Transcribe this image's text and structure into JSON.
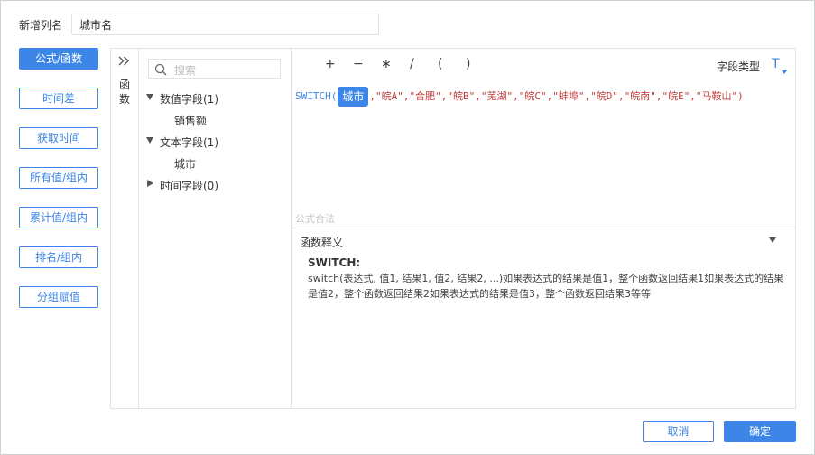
{
  "header": {
    "column_name_label": "新增列名",
    "column_name_value": "城市名"
  },
  "left_menu": {
    "items": [
      {
        "label": "公式/函数",
        "active": true
      },
      {
        "label": "时间差",
        "active": false
      },
      {
        "label": "获取时间",
        "active": false
      },
      {
        "label": "所有值/组内",
        "active": false
      },
      {
        "label": "累计值/组内",
        "active": false
      },
      {
        "label": "排名/组内",
        "active": false
      },
      {
        "label": "分组赋值",
        "active": false
      }
    ]
  },
  "function_panel": {
    "label": "函数",
    "toggle_icon": "double-chevron-right-icon"
  },
  "fields": {
    "search_placeholder": "搜索",
    "groups": [
      {
        "label": "数值字段(1)",
        "expanded": true,
        "children": [
          "销售额"
        ]
      },
      {
        "label": "文本字段(1)",
        "expanded": true,
        "children": [
          "城市"
        ]
      },
      {
        "label": "时间字段(0)",
        "expanded": false,
        "children": []
      }
    ]
  },
  "toolbar": {
    "operators": [
      "+",
      "−",
      "∗",
      "/",
      "(",
      ")"
    ],
    "field_type_label": "字段类型",
    "field_type_value": "T"
  },
  "formula": {
    "function": "SWITCH",
    "open_paren": "(",
    "field_chip": "城市",
    "rest": ",\"皖A\",\"合肥\",\"皖B\",\"芜湖\",\"皖C\",\"蚌埠\",\"皖D\",\"皖南\",\"皖E\",\"马鞍山\")"
  },
  "status": {
    "legal_text": "公式合法"
  },
  "explain": {
    "title": "函数释义",
    "name": "SWITCH:",
    "body": "switch(表达式, 值1, 结果1, 值2, 结果2, ...)如果表达式的结果是值1，整个函数返回结果1如果表达式的结果是值2，整个函数返回结果2如果表达式的结果是值3，整个函数返回结果3等等"
  },
  "footer": {
    "cancel_label": "取消",
    "ok_label": "确定"
  },
  "colors": {
    "accent": "#3d85e6",
    "formula_text": "#c23b3b",
    "border": "#e1e4e8"
  }
}
